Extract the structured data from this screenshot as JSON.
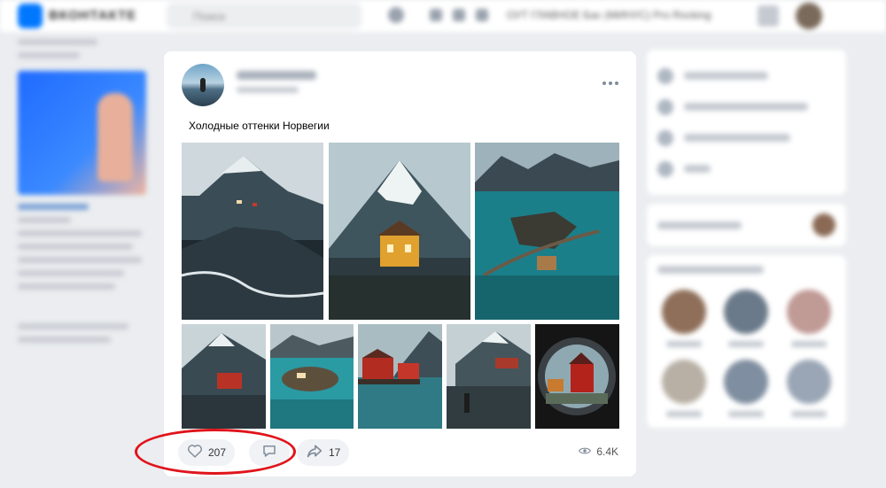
{
  "topbar": {
    "logo_text": "ВКОНТАКТЕ",
    "search_placeholder": "Поиск",
    "player_text": "ОУТ ГЛАВНОЕ Бас (МИНУС) Pro Rocking"
  },
  "post": {
    "text": "Холодные оттенки Норвегии",
    "likes": "207",
    "shares": "17",
    "views": "6.4K"
  },
  "icons": {
    "more": "more-dots-icon",
    "like": "heart-icon",
    "comment": "comment-icon",
    "share": "share-arrow-icon",
    "views": "eye-icon"
  },
  "colors": {
    "highlight": "#e0141b",
    "accent": "#0077ff"
  }
}
